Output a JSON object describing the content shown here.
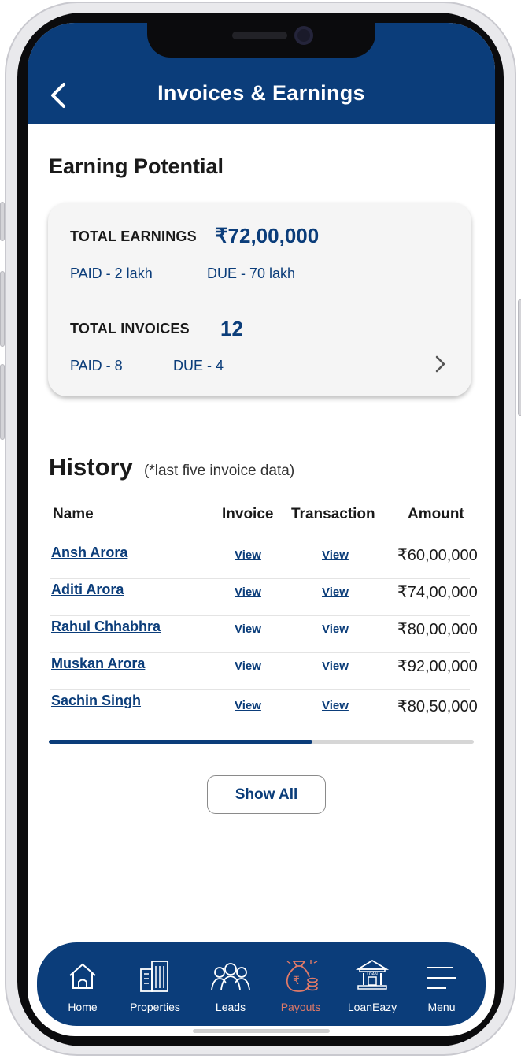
{
  "header": {
    "title": "Invoices & Earnings"
  },
  "earning_potential": {
    "title": "Earning Potential",
    "total_earnings_label": "TOTAL EARNINGS",
    "total_earnings_value": "₹72,00,000",
    "paid_earnings": "PAID - 2 lakh",
    "due_earnings": "DUE - 70 lakh",
    "total_invoices_label": "TOTAL INVOICES",
    "total_invoices_value": "12",
    "paid_invoices": "PAID - 8",
    "due_invoices": "DUE - 4"
  },
  "history": {
    "title": "History",
    "note": "(*last five invoice data)",
    "columns": [
      "Name",
      "Invoice",
      "Transaction",
      "Amount"
    ],
    "rows": [
      {
        "name": "Ansh Arora",
        "invoice": "View",
        "transaction": "View",
        "amount": "₹60,00,000"
      },
      {
        "name": "Aditi Arora",
        "invoice": "View",
        "transaction": "View",
        "amount": "₹74,00,000"
      },
      {
        "name": "Rahul Chhabhra",
        "invoice": "View",
        "transaction": "View",
        "amount": "₹80,00,000"
      },
      {
        "name": "Muskan Arora",
        "invoice": "View",
        "transaction": "View",
        "amount": "₹92,00,000"
      },
      {
        "name": "Sachin Singh",
        "invoice": "View",
        "transaction": "View",
        "amount": "₹80,50,000"
      }
    ],
    "scroll_progress": 0.62,
    "show_all_label": "Show All"
  },
  "bottom_nav": {
    "items": [
      {
        "label": "Home",
        "icon": "home-icon"
      },
      {
        "label": "Properties",
        "icon": "building-icon"
      },
      {
        "label": "Leads",
        "icon": "people-icon"
      },
      {
        "label": "Payouts",
        "icon": "money-bag-icon",
        "active": true
      },
      {
        "label": "LoanEazy",
        "icon": "bank-icon",
        "icon_text": "LOAN"
      },
      {
        "label": "Menu",
        "icon": "menu-icon"
      }
    ]
  },
  "colors": {
    "primary": "#0b3d7a",
    "active": "#e07a68",
    "card": "#f5f5f5"
  }
}
